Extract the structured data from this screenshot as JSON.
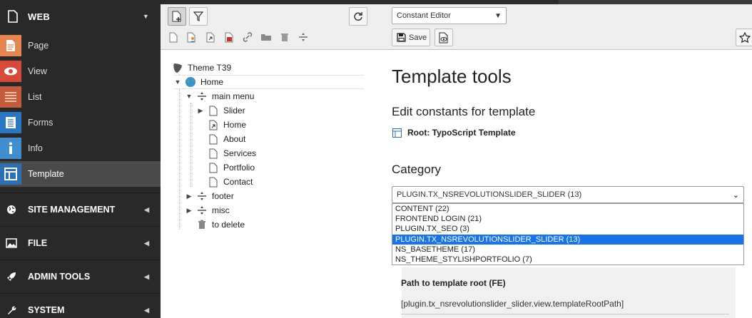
{
  "module_menu": {
    "web_header": "WEB",
    "items": [
      {
        "label": "Page",
        "icon": "page-icon",
        "color": "#e8844d"
      },
      {
        "label": "View",
        "icon": "eye-icon",
        "color": "#d74a3a"
      },
      {
        "label": "List",
        "icon": "list-icon",
        "color": "#c45a3c"
      },
      {
        "label": "Forms",
        "icon": "forms-icon",
        "color": "#2b78c2"
      },
      {
        "label": "Info",
        "icon": "info-icon",
        "color": "#3e8ed0"
      },
      {
        "label": "Template",
        "icon": "template-icon",
        "color": "#2d6fb3"
      }
    ],
    "groups": [
      {
        "label": "SITE MANAGEMENT",
        "icon": "globe-icon"
      },
      {
        "label": "FILE",
        "icon": "image-icon"
      },
      {
        "label": "ADMIN TOOLS",
        "icon": "rocket-icon"
      },
      {
        "label": "SYSTEM",
        "icon": "wrench-icon"
      }
    ]
  },
  "page_tree": {
    "root": "Theme T39",
    "nodes": [
      {
        "label": "Home"
      },
      {
        "label": "main menu"
      },
      {
        "label": "Slider"
      },
      {
        "label": "Home"
      },
      {
        "label": "About"
      },
      {
        "label": "Services"
      },
      {
        "label": "Portfolio"
      },
      {
        "label": "Contact"
      },
      {
        "label": "footer"
      },
      {
        "label": "misc"
      },
      {
        "label": "to delete"
      }
    ]
  },
  "docheader": {
    "function_select": "Constant Editor",
    "save_label": "Save"
  },
  "main": {
    "title": "Template tools",
    "subtitle": "Edit constants for template",
    "root_template": "Root: TypoScript Template",
    "category_heading": "Category",
    "category_selected": "PLUGIN.TX_NSREVOLUTIONSLIDER_SLIDER (13)",
    "category_options": [
      "CONTENT (22)",
      "FRONTEND LOGIN (21)",
      "PLUGIN.TX_SEO (3)",
      "PLUGIN.TX_NSREVOLUTIONSLIDER_SLIDER (13)",
      "NS_BASETHEME (17)",
      "NS_THEME_STYLISHPORTFOLIO (7)"
    ],
    "highlighted_option_index": 3,
    "field_label": "Path to template root (FE)",
    "field_value": "[plugin.tx_nsrevolutionslider_slider.view.templateRootPath]"
  },
  "colors": {
    "accent": "#1a73e8",
    "menu_bg": "#292929"
  }
}
